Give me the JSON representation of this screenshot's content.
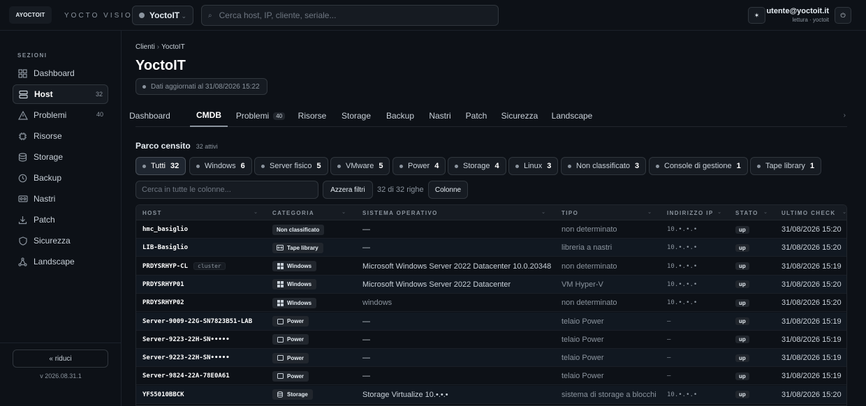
{
  "app": {
    "logo_text": "AYOCTOIT",
    "brand": "YOCTO VISION",
    "tenant": "YoctoIT",
    "search_placeholder": "Cerca host, IP, cliente, seriale...",
    "theme_icon": "sun-icon",
    "user_email": "utente@yoctoit.it",
    "user_role": "lettura · yoctoit",
    "power_icon": "power-icon"
  },
  "sidebar": {
    "title": "SEZIONI",
    "items": [
      {
        "label": "Dashboard",
        "icon": "grid-icon",
        "count": ""
      },
      {
        "label": "Host",
        "icon": "server-icon",
        "count": "32"
      },
      {
        "label": "Problemi",
        "icon": "warning-icon",
        "count": "40"
      },
      {
        "label": "Risorse",
        "icon": "chip-icon",
        "count": ""
      },
      {
        "label": "Storage",
        "icon": "database-icon",
        "count": ""
      },
      {
        "label": "Backup",
        "icon": "backup-icon",
        "count": ""
      },
      {
        "label": "Nastri",
        "icon": "tape-icon",
        "count": ""
      },
      {
        "label": "Patch",
        "icon": "download-icon",
        "count": ""
      },
      {
        "label": "Sicurezza",
        "icon": "shield-icon",
        "count": ""
      },
      {
        "label": "Landscape",
        "icon": "network-icon",
        "count": ""
      }
    ],
    "collapse_label": "« riduci",
    "version": "v 2026.08.31.1"
  },
  "breadcrumb": {
    "root": "Clienti",
    "sep": "›",
    "current": "YoctoIT"
  },
  "page": {
    "title": "YoctoIT",
    "updated": "Dati aggiornati al 31/08/2026 15:22"
  },
  "tabs": [
    {
      "label": "Dashboard",
      "badge": ""
    },
    {
      "label": "CMDB",
      "badge": ""
    },
    {
      "label": "Problemi",
      "badge": "40"
    },
    {
      "label": "Risorse",
      "badge": ""
    },
    {
      "label": "Storage",
      "badge": ""
    },
    {
      "label": "Backup",
      "badge": ""
    },
    {
      "label": "Nastri",
      "badge": ""
    },
    {
      "label": "Patch",
      "badge": ""
    },
    {
      "label": "Sicurezza",
      "badge": ""
    },
    {
      "label": "Landscape",
      "badge": ""
    }
  ],
  "tabs_more": "›",
  "parco": {
    "title": "Parco censito",
    "subtitle": "32 attivi"
  },
  "chips": [
    {
      "label": "Tutti",
      "count": "32"
    },
    {
      "label": "Windows",
      "count": "6"
    },
    {
      "label": "Server fisico",
      "count": "5"
    },
    {
      "label": "VMware",
      "count": "5"
    },
    {
      "label": "Power",
      "count": "4"
    },
    {
      "label": "Storage",
      "count": "4"
    },
    {
      "label": "Linux",
      "count": "3"
    },
    {
      "label": "Non classificato",
      "count": "3"
    },
    {
      "label": "Console di gestione",
      "count": "1"
    },
    {
      "label": "Tape library",
      "count": "1"
    }
  ],
  "toolbar": {
    "filter_placeholder": "Cerca in tutte le colonne...",
    "reset_label": "Azzera filtri",
    "rowcount": "32 di 32 righe",
    "columns_label": "Colonne"
  },
  "table": {
    "headers": [
      "HOST",
      "CATEGORIA",
      "SISTEMA OPERATIVO",
      "TIPO",
      "INDIRIZZO IP",
      "STATO",
      "ULTIMO CHECK"
    ],
    "sort_icon": "⌄",
    "rows": [
      {
        "host": "hmc_basiglio",
        "tag": "",
        "cat": "Non classificato",
        "cat_icon": "",
        "os": "—",
        "os_muted": false,
        "tipo": "non determinato",
        "ip": "10.•.•.•",
        "stato": "up",
        "check": "31/08/2026 15:20"
      },
      {
        "host": "LIB-Basiglio",
        "tag": "",
        "cat": "Tape library",
        "cat_icon": "tape-icon",
        "os": "—",
        "os_muted": false,
        "tipo": "libreria a nastri",
        "ip": "10.•.•.•",
        "stato": "up",
        "check": "31/08/2026 15:20"
      },
      {
        "host": "PRDYSRHYP-CL",
        "tag": "cluster",
        "cat": "Windows",
        "cat_icon": "windows-icon",
        "os": "Microsoft Windows Server 2022 Datacenter 10.0.20348",
        "os_muted": false,
        "tipo": "non determinato",
        "ip": "10.•.•.•",
        "stato": "up",
        "check": "31/08/2026 15:19"
      },
      {
        "host": "PRDYSRHYP01",
        "tag": "",
        "cat": "Windows",
        "cat_icon": "windows-icon",
        "os": "Microsoft Windows Server 2022 Datacenter",
        "os_muted": false,
        "tipo": "VM Hyper-V",
        "ip": "10.•.•.•",
        "stato": "up",
        "check": "31/08/2026 15:20"
      },
      {
        "host": "PRDYSRHYP02",
        "tag": "",
        "cat": "Windows",
        "cat_icon": "windows-icon",
        "os": "windows",
        "os_muted": true,
        "tipo": "non determinato",
        "ip": "10.•.•.•",
        "stato": "up",
        "check": "31/08/2026 15:20"
      },
      {
        "host": "Server-9009-22G-SN7823B51-LAB",
        "tag": "",
        "cat": "Power",
        "cat_icon": "power-system-icon",
        "os": "—",
        "os_muted": false,
        "tipo": "telaio Power",
        "ip": "—",
        "stato": "up",
        "check": "31/08/2026 15:19"
      },
      {
        "host": "Server-9223-22H-SN•••••",
        "tag": "",
        "cat": "Power",
        "cat_icon": "power-system-icon",
        "os": "—",
        "os_muted": false,
        "tipo": "telaio Power",
        "ip": "—",
        "stato": "up",
        "check": "31/08/2026 15:19"
      },
      {
        "host": "Server-9223-22H-SN•••••",
        "tag": "",
        "cat": "Power",
        "cat_icon": "power-system-icon",
        "os": "—",
        "os_muted": false,
        "tipo": "telaio Power",
        "ip": "—",
        "stato": "up",
        "check": "31/08/2026 15:19"
      },
      {
        "host": "Server-9824-22A-78E0A61",
        "tag": "",
        "cat": "Power",
        "cat_icon": "power-system-icon",
        "os": "—",
        "os_muted": false,
        "tipo": "telaio Power",
        "ip": "—",
        "stato": "up",
        "check": "31/08/2026 15:19"
      },
      {
        "host": "YFS5010BBCK",
        "tag": "",
        "cat": "Storage",
        "cat_icon": "database-icon",
        "os": "Storage Virtualize 10.•.•.•",
        "os_muted": false,
        "tipo": "sistema di storage a blocchi",
        "ip": "10.•.•.•",
        "stato": "up",
        "check": "31/08/2026 15:20"
      }
    ]
  }
}
